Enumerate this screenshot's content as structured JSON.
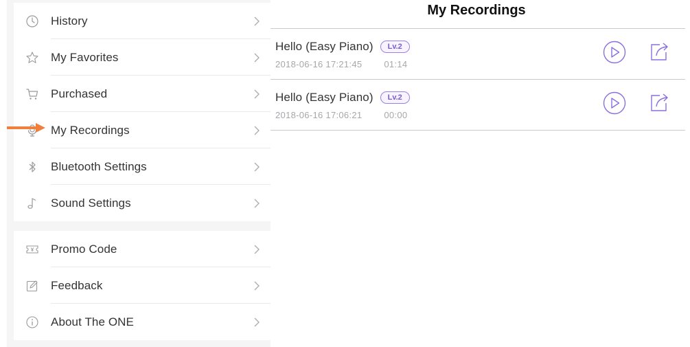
{
  "sidebar": {
    "groups": [
      {
        "items": [
          {
            "label": "History",
            "icon": "clock-icon"
          },
          {
            "label": "My Favorites",
            "icon": "star-icon"
          },
          {
            "label": "Purchased",
            "icon": "cart-icon"
          },
          {
            "label": "My Recordings",
            "icon": "microphone-icon"
          },
          {
            "label": "Bluetooth Settings",
            "icon": "bluetooth-icon"
          },
          {
            "label": "Sound Settings",
            "icon": "music-note-icon"
          }
        ]
      },
      {
        "items": [
          {
            "label": "Promo Code",
            "icon": "ticket-icon"
          },
          {
            "label": "Feedback",
            "icon": "edit-icon"
          },
          {
            "label": "About The ONE",
            "icon": "info-icon"
          }
        ]
      }
    ]
  },
  "annotation": {
    "arrow_color": "#f07f3c"
  },
  "main": {
    "title": "My Recordings",
    "recordings": [
      {
        "title": "Hello (Easy Piano)",
        "level": "Lv.2",
        "date": "2018-06-16 17:21:45",
        "duration": "01:14"
      },
      {
        "title": "Hello (Easy Piano)",
        "level": "Lv.2",
        "date": "2018-06-16 17:06:21",
        "duration": "00:00"
      }
    ]
  },
  "colors": {
    "accent": "#8a6ee0",
    "text": "#333333",
    "muted": "#a7a7ab",
    "sidebar_bg": "#f5f5f6"
  }
}
